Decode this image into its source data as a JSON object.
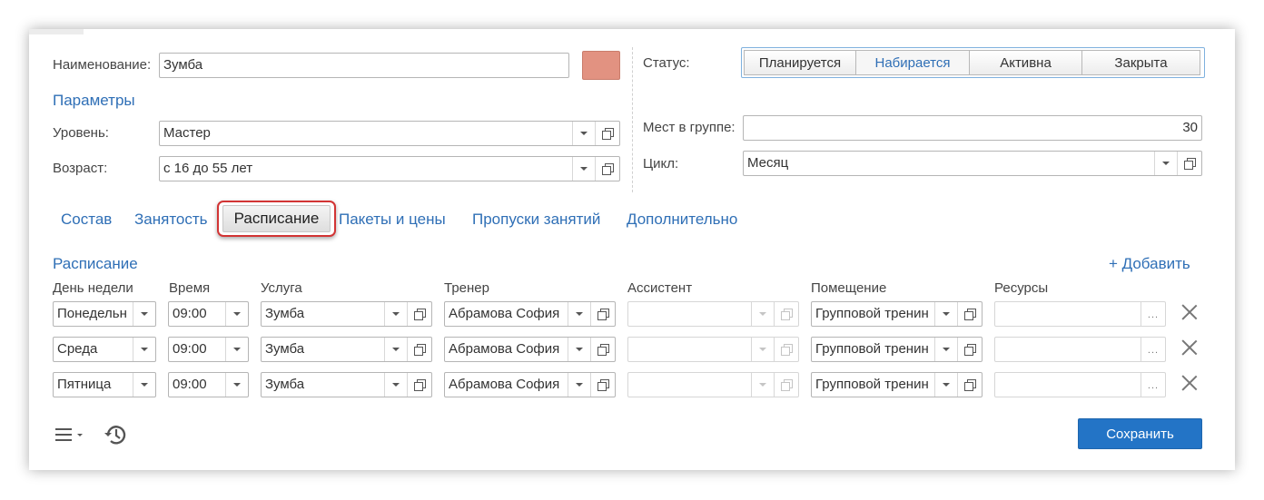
{
  "header": {
    "name_label": "Наименование:",
    "name_value": "Зумба",
    "swatch_color": "#e29281",
    "status_label": "Статус:",
    "status_options": [
      "Планируется",
      "Набирается",
      "Активна",
      "Закрыта"
    ],
    "status_selected": "Набирается"
  },
  "params": {
    "title": "Параметры",
    "level_label": "Уровень:",
    "level_value": "Мастер",
    "age_label": "Возраст:",
    "age_value": "с 16 до 55 лет",
    "seats_label": "Мест в группе:",
    "seats_value": "30",
    "cycle_label": "Цикл:",
    "cycle_value": "Месяц"
  },
  "tabs": [
    "Состав",
    "Занятость",
    "Расписание",
    "Пакеты и цены",
    "Пропуски занятий",
    "Дополнительно"
  ],
  "active_tab": "Расписание",
  "schedule": {
    "title": "Расписание",
    "add_label": "+ Добавить",
    "columns": [
      "День недели",
      "Время",
      "Услуга",
      "Тренер",
      "Ассистент",
      "Помещение",
      "Ресурсы"
    ],
    "rows": [
      {
        "day": "Понедельн",
        "time": "09:00",
        "service": "Зумба",
        "trainer": "Абрамова София",
        "assistant": "",
        "room": "Групповой тренин",
        "resources": ""
      },
      {
        "day": "Среда",
        "time": "09:00",
        "service": "Зумба",
        "trainer": "Абрамова София",
        "assistant": "",
        "room": "Групповой тренин",
        "resources": ""
      },
      {
        "day": "Пятница",
        "time": "09:00",
        "service": "Зумба",
        "trainer": "Абрамова София",
        "assistant": "",
        "room": "Групповой тренин",
        "resources": ""
      }
    ],
    "resources_button": "..."
  },
  "footer": {
    "menu_icon": "menu-icon",
    "history_icon": "history-icon",
    "save_label": "Сохранить",
    "accent_color": "#2374c6"
  }
}
